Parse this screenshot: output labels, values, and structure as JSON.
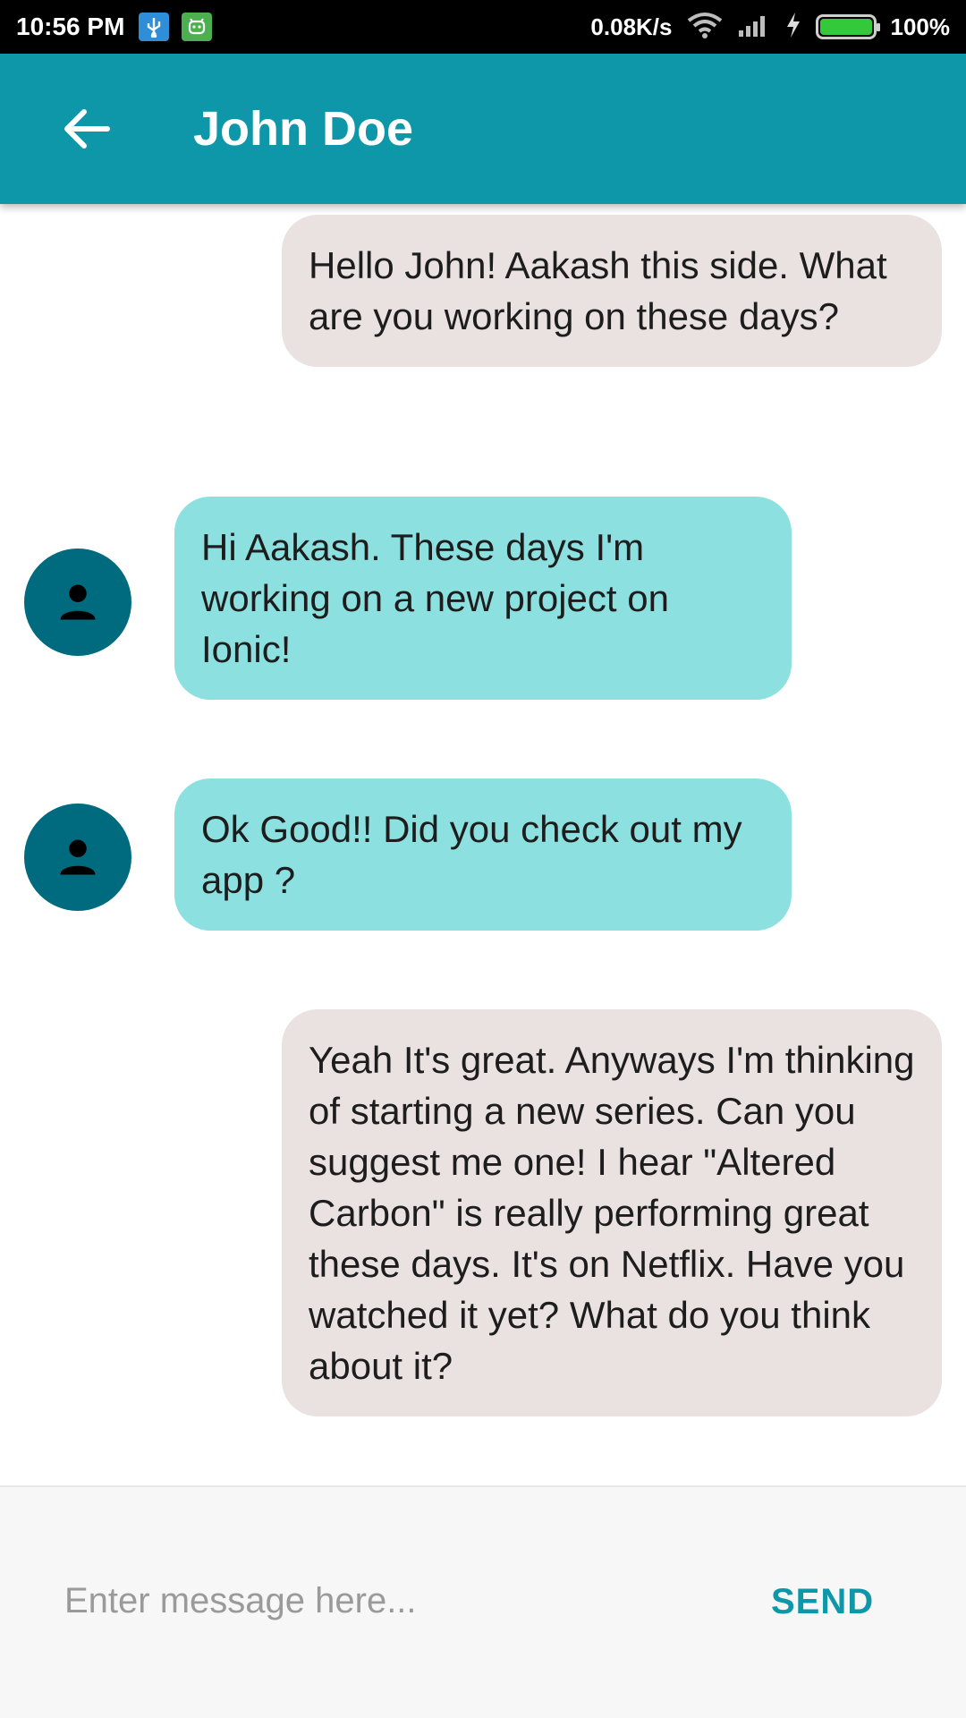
{
  "status_bar": {
    "time": "10:56 PM",
    "net_speed": "0.08K/s",
    "battery_percent": "100%",
    "icons": [
      "usb-debug-icon",
      "android-bot-icon",
      "wifi-icon",
      "cellular-signal-icon",
      "charging-bolt-icon",
      "battery-icon"
    ]
  },
  "toolbar": {
    "title": "John Doe",
    "back_icon": "arrow-left-icon",
    "background": "#0e97a9"
  },
  "messages": [
    {
      "side": "sent",
      "text": "Hello John! Aakash this side. What are you working on these days?"
    },
    {
      "side": "received",
      "text": "Hi Aakash. These days I'm working on a new project on Ionic!"
    },
    {
      "side": "received",
      "text": "Ok Good!! Did you check out my app ?"
    },
    {
      "side": "sent",
      "text": "Yeah It's great. Anyways I'm thinking of starting a new series. Can you suggest me one! I hear \"Altered Carbon\" is really performing great these days. It's on Netflix. Have you watched it yet? What do you think about it?"
    }
  ],
  "composer": {
    "placeholder": "Enter message here...",
    "value": "",
    "send_label": "SEND"
  },
  "colors": {
    "accent": "#0e97a9",
    "sent_bubble": "#e9e2e1",
    "received_bubble": "#8de0e0",
    "avatar": "#006b7f"
  }
}
